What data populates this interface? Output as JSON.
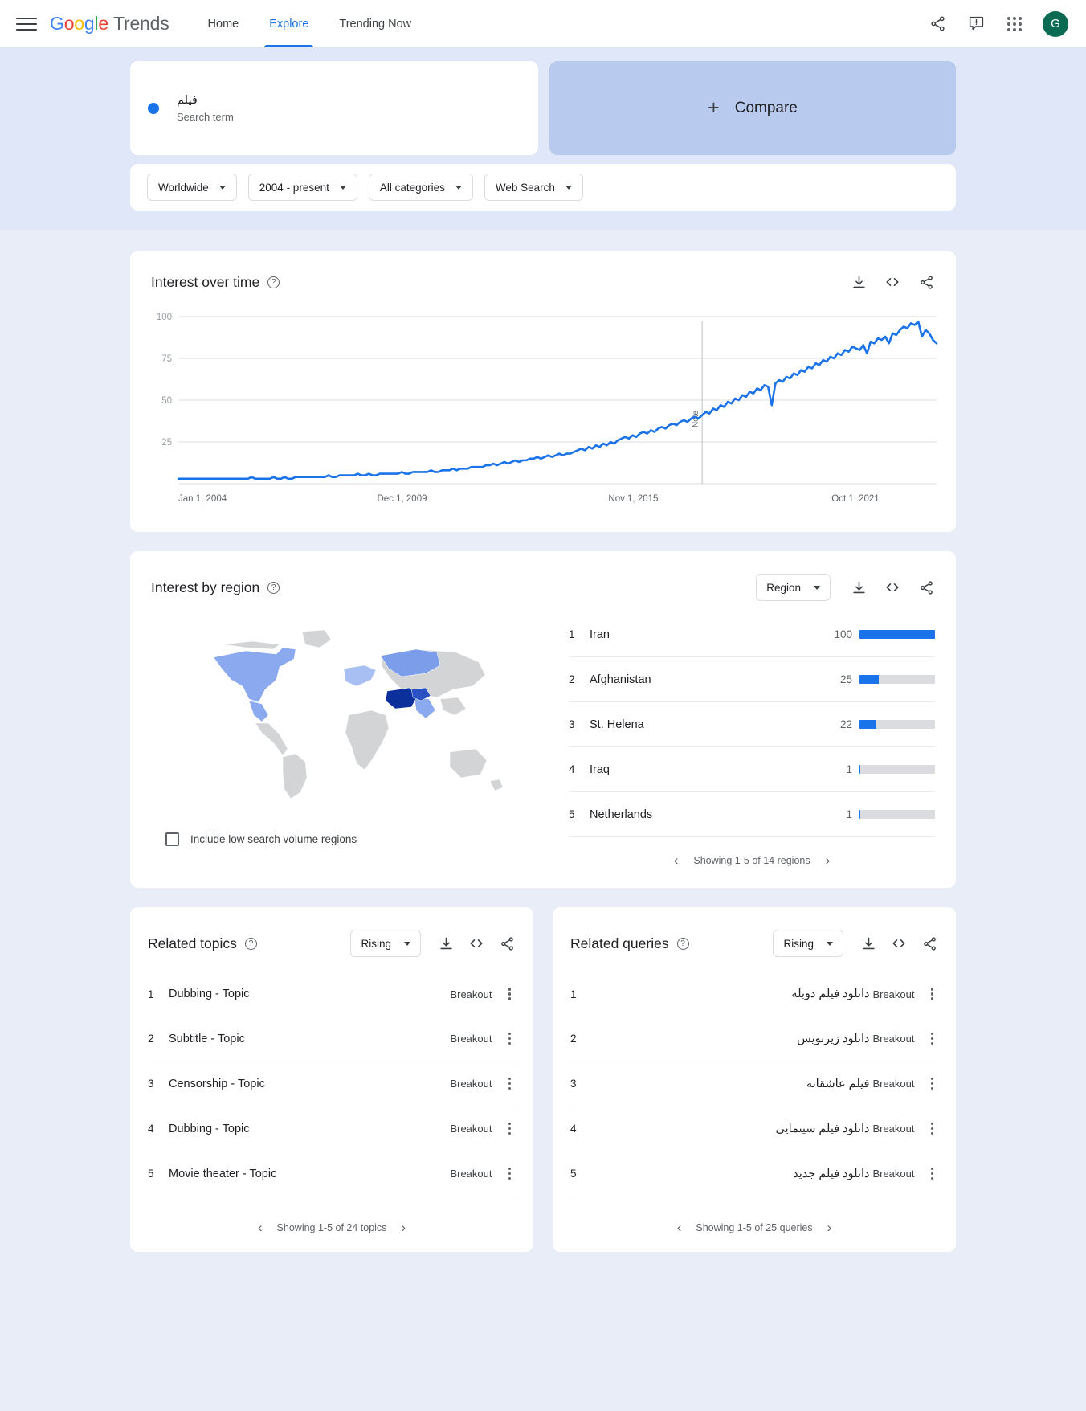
{
  "header": {
    "menu": "menu-icon",
    "brand": "Google Trends",
    "brand_word": "Google",
    "brand_suffix": "Trends",
    "nav": [
      {
        "label": "Home",
        "active": false
      },
      {
        "label": "Explore",
        "active": true
      },
      {
        "label": "Trending Now",
        "active": false
      }
    ],
    "icons": [
      "share-icon",
      "feedback-icon",
      "apps-grid-icon"
    ],
    "avatar_letter": "G",
    "avatar_color": "#0b6b52"
  },
  "query": {
    "term": "فیلم",
    "term_type": "Search term",
    "dot_color": "#1a73e8",
    "compare_label": "Compare",
    "compare_plus": "+"
  },
  "filters": [
    {
      "label": "Worldwide"
    },
    {
      "label": "2004 - present"
    },
    {
      "label": "All categories"
    },
    {
      "label": "Web Search"
    }
  ],
  "interest_over_time": {
    "title": "Interest over time",
    "help": "?",
    "actions": [
      "download-icon",
      "embed-icon",
      "share-icon"
    ]
  },
  "chart_data": {
    "type": "line",
    "title": "Interest over time",
    "xlabel": "",
    "ylabel": "",
    "ylim": [
      0,
      100
    ],
    "yticks": [
      25,
      50,
      75,
      100
    ],
    "xtick_labels": [
      "Jan 1, 2004",
      "Dec 1, 2009",
      "Nov 1, 2015",
      "Oct 1, 2021"
    ],
    "grid": true,
    "legend": "none",
    "series": [
      {
        "name": "فیلم",
        "color": "#1a73e8",
        "values": [
          3,
          3,
          3,
          3,
          3,
          3,
          3,
          3,
          3,
          3,
          3,
          3,
          3,
          3,
          3,
          3,
          3,
          3,
          3,
          3,
          4,
          3,
          3,
          3,
          3,
          3,
          4,
          3,
          3,
          4,
          3,
          3,
          4,
          4,
          4,
          4,
          4,
          4,
          4,
          4,
          4,
          5,
          4,
          4,
          5,
          5,
          5,
          5,
          5,
          6,
          5,
          5,
          6,
          5,
          5,
          6,
          6,
          6,
          6,
          6,
          6,
          7,
          6,
          6,
          7,
          7,
          7,
          7,
          7,
          8,
          7,
          7,
          8,
          8,
          8,
          9,
          8,
          9,
          9,
          9,
          10,
          10,
          10,
          10,
          11,
          11,
          12,
          11,
          12,
          13,
          12,
          13,
          14,
          13,
          14,
          14,
          15,
          15,
          16,
          15,
          16,
          17,
          16,
          17,
          18,
          17,
          18,
          18,
          19,
          20,
          21,
          20,
          22,
          21,
          23,
          22,
          24,
          23,
          25,
          24,
          26,
          27,
          28,
          27,
          29,
          28,
          30,
          31,
          30,
          32,
          31,
          33,
          34,
          33,
          35,
          36,
          35,
          37,
          38,
          37,
          39,
          40,
          39,
          41,
          43,
          42,
          45,
          44,
          47,
          46,
          49,
          48,
          51,
          50,
          53,
          52,
          55,
          54,
          57,
          56,
          59,
          58,
          47,
          60,
          62,
          61,
          64,
          63,
          66,
          65,
          68,
          67,
          70,
          69,
          72,
          71,
          74,
          73,
          76,
          75,
          78,
          77,
          80,
          79,
          82,
          81,
          80,
          83,
          78,
          85,
          84,
          87,
          86,
          88,
          84,
          90,
          89,
          92,
          94,
          93,
          96,
          95,
          97,
          88,
          92,
          90,
          86,
          84
        ],
        "annotations": [
          {
            "label": "Note",
            "x_index": 143
          },
          {
            "label": "Note",
            "x_index": 213
          }
        ]
      }
    ]
  },
  "interest_by_region": {
    "title": "Interest by region",
    "help": "?",
    "dropdown": "Region",
    "actions": [
      "download-icon",
      "embed-icon",
      "share-icon"
    ],
    "include_low_volume_label": "Include low search volume regions",
    "rows": [
      {
        "rank": "1",
        "name": "Iran",
        "value": "100",
        "pct": 100
      },
      {
        "rank": "2",
        "name": "Afghanistan",
        "value": "25",
        "pct": 25
      },
      {
        "rank": "3",
        "name": "St. Helena",
        "value": "22",
        "pct": 22
      },
      {
        "rank": "4",
        "name": "Iraq",
        "value": "1",
        "pct": 1
      },
      {
        "rank": "5",
        "name": "Netherlands",
        "value": "1",
        "pct": 1
      }
    ],
    "pagination": "Showing 1-5 of 14 regions"
  },
  "related_topics": {
    "title": "Related topics",
    "help": "?",
    "dropdown": "Rising",
    "actions": [
      "download-icon",
      "embed-icon",
      "share-icon"
    ],
    "rows": [
      {
        "rank": "1",
        "name": "Dubbing - Topic",
        "value": "Breakout"
      },
      {
        "rank": "2",
        "name": "Subtitle - Topic",
        "value": "Breakout"
      },
      {
        "rank": "3",
        "name": "Censorship - Topic",
        "value": "Breakout"
      },
      {
        "rank": "4",
        "name": "Dubbing - Topic",
        "value": "Breakout"
      },
      {
        "rank": "5",
        "name": "Movie theater - Topic",
        "value": "Breakout"
      }
    ],
    "pagination": "Showing 1-5 of 24 topics"
  },
  "related_queries": {
    "title": "Related queries",
    "help": "?",
    "dropdown": "Rising",
    "actions": [
      "download-icon",
      "embed-icon",
      "share-icon"
    ],
    "rows": [
      {
        "rank": "1",
        "name": "دانلود فیلم دوبله",
        "value": "Breakout"
      },
      {
        "rank": "2",
        "name": "دانلود زیرنویس",
        "value": "Breakout"
      },
      {
        "rank": "3",
        "name": "فیلم عاشقانه",
        "value": "Breakout"
      },
      {
        "rank": "4",
        "name": "دانلود فیلم سینمایی",
        "value": "Breakout"
      },
      {
        "rank": "5",
        "name": "دانلود فیلم جدید",
        "value": "Breakout"
      }
    ],
    "pagination": "Showing 1-5 of 25 queries"
  }
}
